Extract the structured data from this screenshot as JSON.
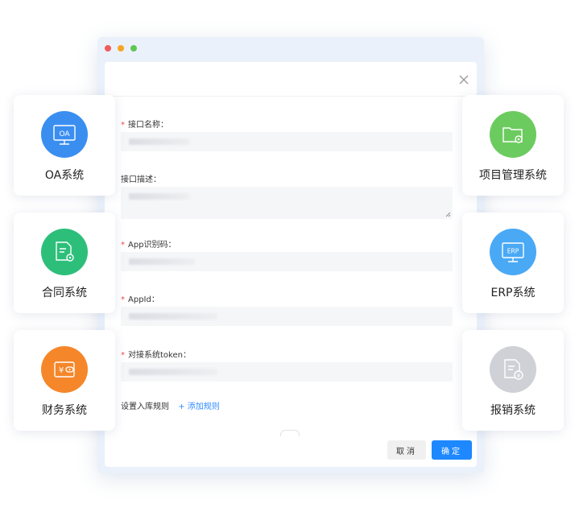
{
  "dialog": {
    "fields": [
      {
        "label": "接口名称：",
        "required": true
      },
      {
        "label": "接口描述：",
        "required": false
      },
      {
        "label": "App识别码：",
        "required": true
      },
      {
        "label": "AppId：",
        "required": true
      },
      {
        "label": "对接系统token：",
        "required": true
      }
    ],
    "rule_label": "设置入库规则",
    "add_rule": "+ 添加规则",
    "cancel": "取消",
    "confirm": "确定"
  },
  "cards": [
    {
      "label": "OA系统",
      "icon": "oa-monitor-icon",
      "color": "#3a8ef0"
    },
    {
      "label": "合同系统",
      "icon": "contract-document-icon",
      "color": "#2dbf7a"
    },
    {
      "label": "财务系统",
      "icon": "finance-wallet-icon",
      "color": "#f5872a"
    },
    {
      "label": "项目管理系统",
      "icon": "project-folder-icon",
      "color": "#6ccb5f"
    },
    {
      "label": "ERP系统",
      "icon": "erp-monitor-icon",
      "color": "#4aa9f5"
    },
    {
      "label": "报销系统",
      "icon": "reimbursement-document-icon",
      "color": "#cfd1d6"
    }
  ]
}
